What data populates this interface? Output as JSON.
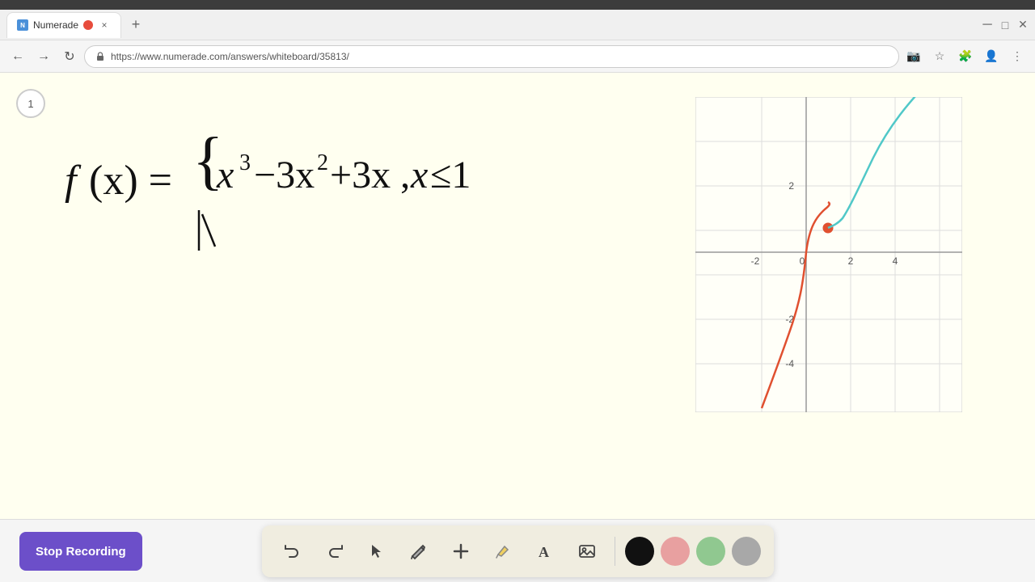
{
  "browser": {
    "title": "Numerade",
    "url": "https://www.numerade.com/answers/whiteboard/35813/",
    "tab_close_label": "×",
    "tab_new_label": "+",
    "nav_back": "‹",
    "nav_forward": "›",
    "nav_refresh": "↻"
  },
  "toolbar": {
    "undo_label": "↺",
    "redo_label": "↻",
    "select_label": "▶",
    "pencil_label": "✏",
    "add_label": "+",
    "highlight_label": "✦",
    "text_label": "A",
    "image_label": "🖼"
  },
  "colors": {
    "black": "#111111",
    "pink": "#e8a0a0",
    "green": "#90c890",
    "gray": "#a0a0a0"
  },
  "bottom": {
    "stop_recording": "Stop Recording"
  },
  "page_indicator": "1",
  "graph": {
    "x_labels": [
      "-2",
      "0",
      "2",
      "4"
    ],
    "y_labels": [
      "-4",
      "-2",
      "2"
    ]
  }
}
